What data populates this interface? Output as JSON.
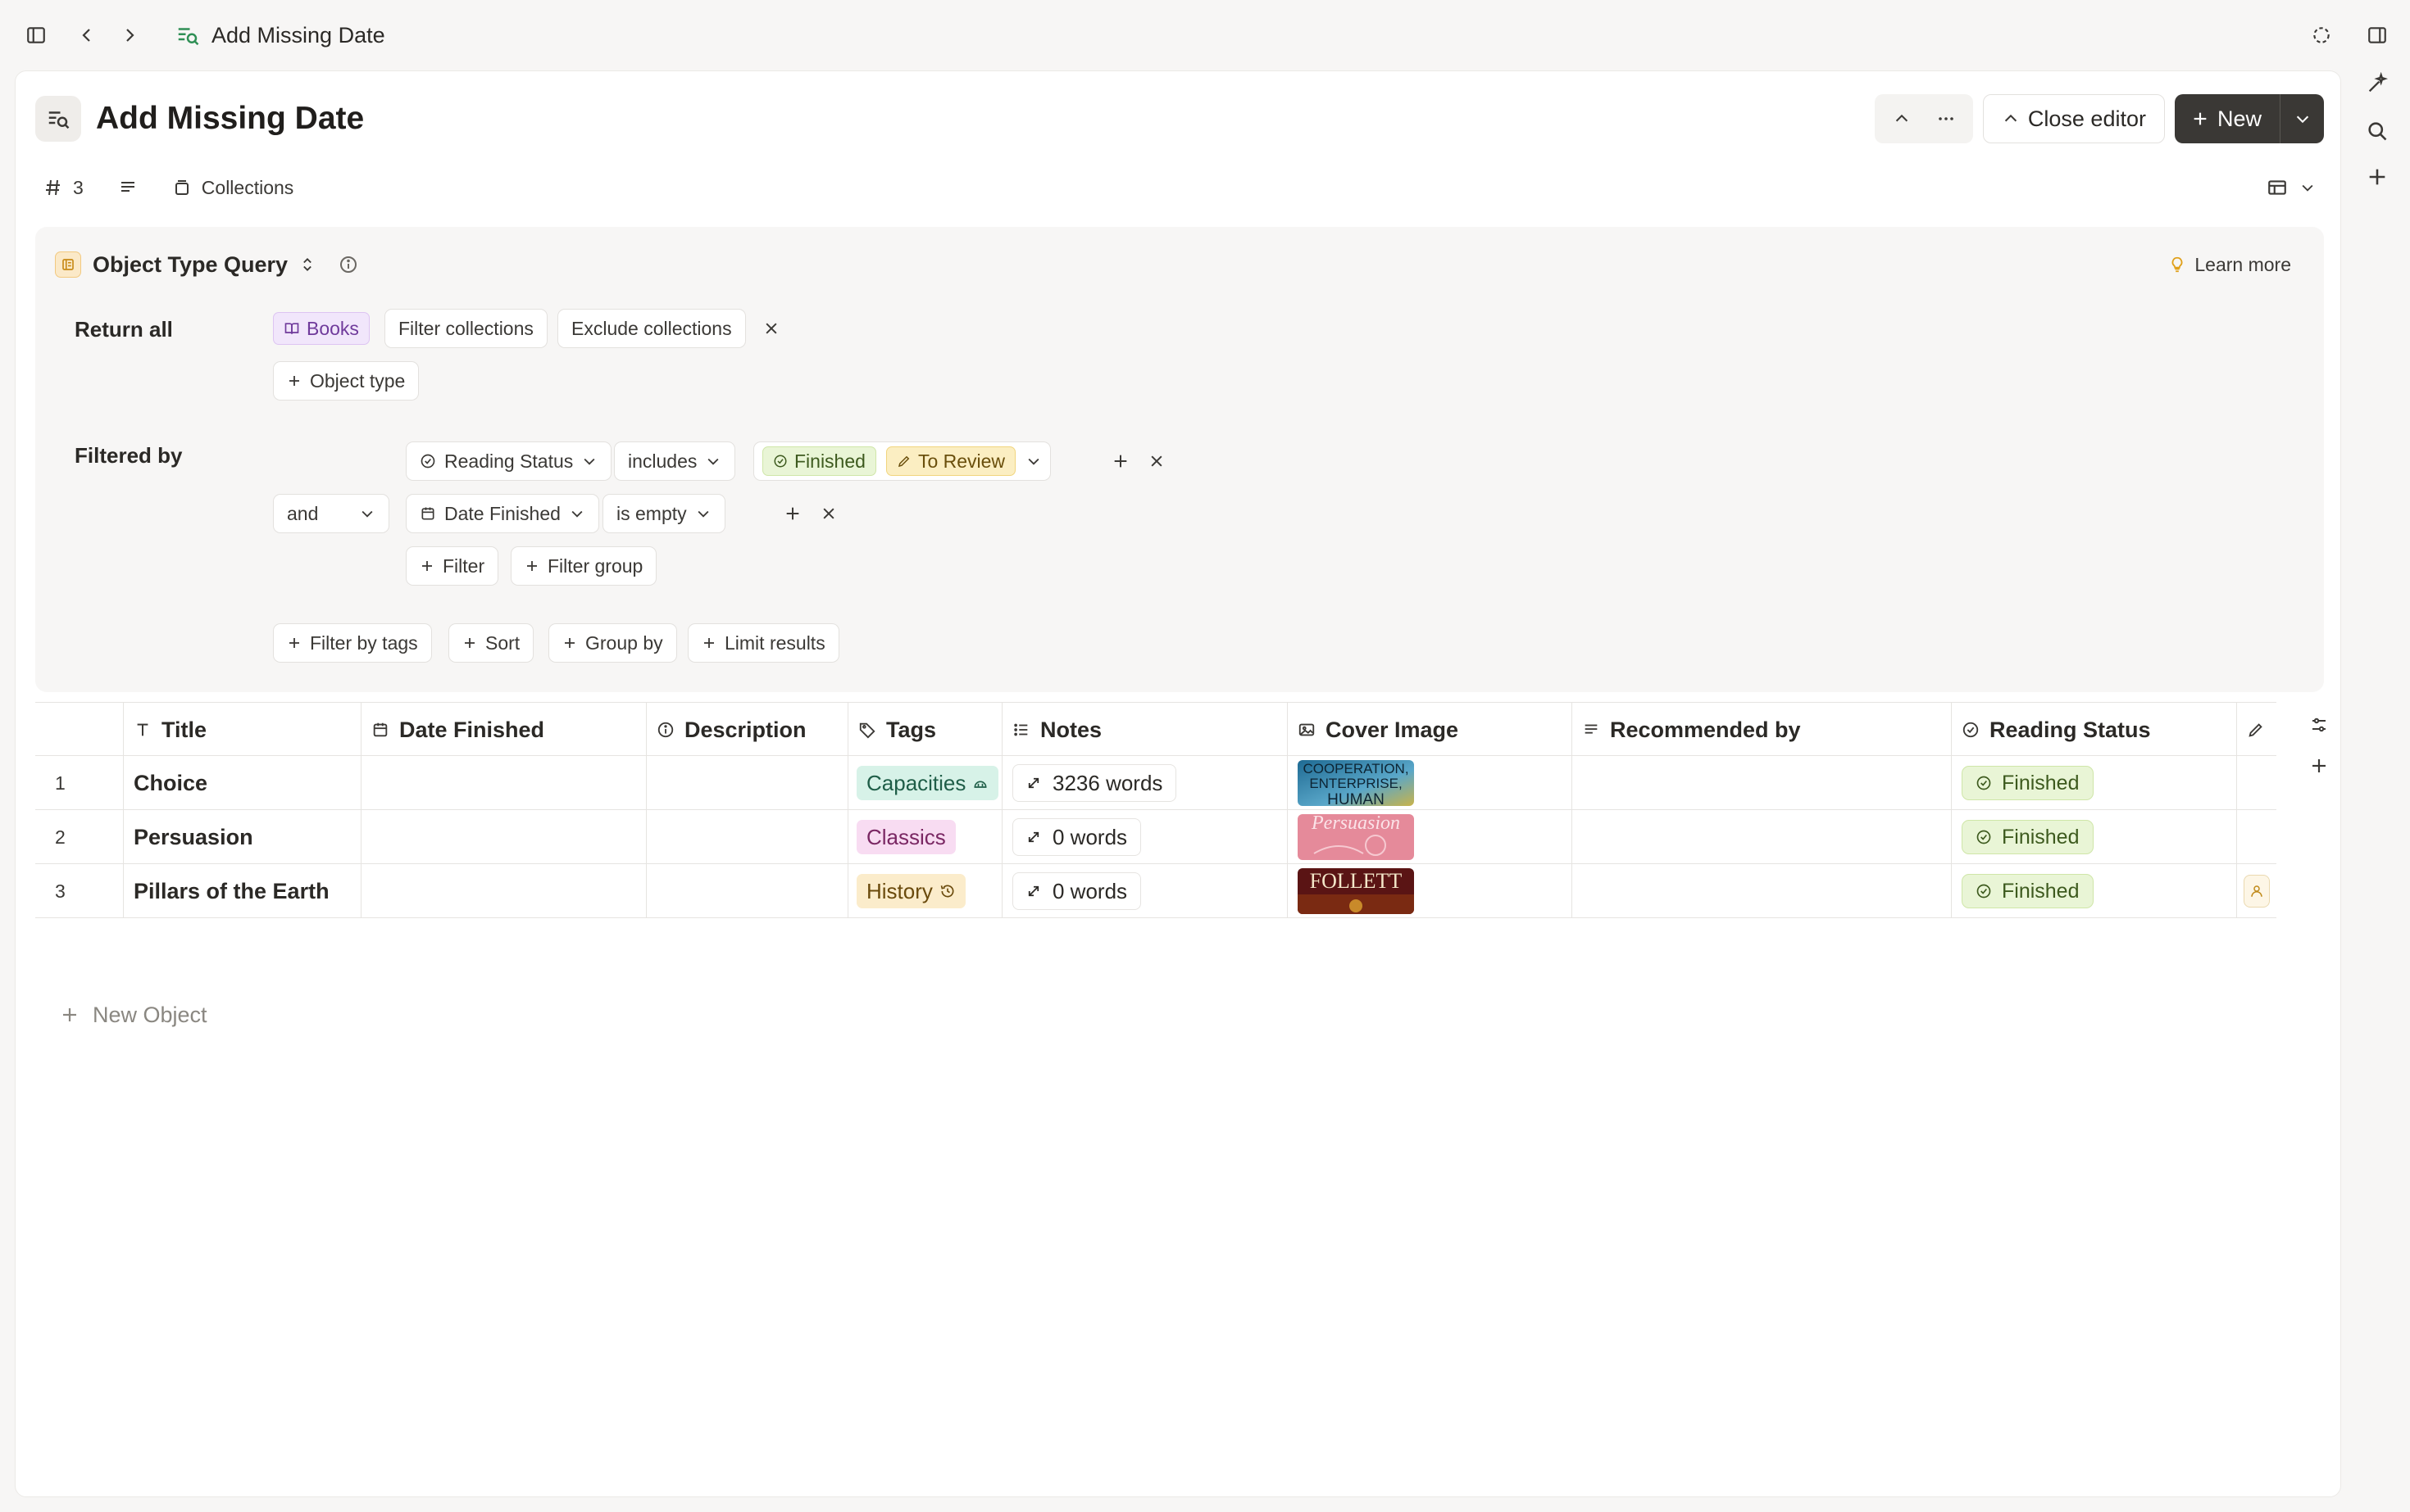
{
  "topbar": {
    "title": "Add Missing Date"
  },
  "header": {
    "title": "Add Missing Date",
    "close_editor_label": "Close editor",
    "new_label": "New"
  },
  "meta": {
    "count": "3",
    "collections_label": "Collections"
  },
  "query": {
    "type_label": "Object Type Query",
    "learn_more": "Learn more",
    "return_label": "Return all",
    "object_types": [
      "Books"
    ],
    "filter_collections": "Filter collections",
    "exclude_collections": "Exclude collections",
    "add_object_type": "Object type",
    "filtered_label": "Filtered by",
    "filters": [
      {
        "property": "Reading Status",
        "operator": "includes",
        "values": [
          "Finished",
          "To Review"
        ]
      },
      {
        "conjunction": "and",
        "property": "Date Finished",
        "operator": "is empty"
      }
    ],
    "add_filter": "Filter",
    "add_filter_group": "Filter group",
    "bottom_actions": [
      "Filter by tags",
      "Sort",
      "Group by",
      "Limit results"
    ]
  },
  "table": {
    "columns": [
      "Title",
      "Date Finished",
      "Description",
      "Tags",
      "Notes",
      "Cover Image",
      "Recommended by",
      "Reading Status"
    ],
    "rows": [
      {
        "num": "1",
        "title": "Choice",
        "date_finished": "",
        "description": "",
        "tag": "Capacities",
        "notes": "3236 words",
        "cover_text": "COOPERATION, ENTERPRISE, HUMAN",
        "recommended_by": "",
        "reading_status": "Finished"
      },
      {
        "num": "2",
        "title": "Persuasion",
        "date_finished": "",
        "description": "",
        "tag": "Classics",
        "notes": "0 words",
        "cover_text": "Persuasion",
        "recommended_by": "",
        "reading_status": "Finished"
      },
      {
        "num": "3",
        "title": "Pillars of the Earth",
        "date_finished": "",
        "description": "",
        "tag": "History",
        "notes": "0 words",
        "cover_text": "FOLLETT",
        "recommended_by": "",
        "reading_status": "Finished"
      }
    ],
    "new_object_label": "New Object"
  },
  "colors": {
    "tag_capacities_bg": "#d7f2e8",
    "tag_classics_bg": "#f8dcf2",
    "tag_history_bg": "#fbeccb",
    "books_tag_bg": "#f1e6fb",
    "finished_bg": "#e9f5d6",
    "to_review_bg": "#fbeec2",
    "new_button_bg": "#3a3835"
  },
  "icons": [
    "sidebar-toggle-icon",
    "back-icon",
    "forward-icon",
    "query-icon",
    "sync-icon",
    "right-panel-icon",
    "sparkle-icon",
    "search-icon",
    "plus-icon",
    "chevron-up-icon",
    "more-icon",
    "hash-icon",
    "text-lines-icon",
    "collection-icon",
    "table-view-icon",
    "bulb-icon",
    "info-icon",
    "book-icon",
    "close-icon",
    "status-icon",
    "calendar-icon",
    "tag-icon",
    "list-icon",
    "image-icon",
    "expand-icon",
    "check-circle-icon",
    "pen-icon",
    "settings-sliders-icon",
    "person-icon"
  ]
}
